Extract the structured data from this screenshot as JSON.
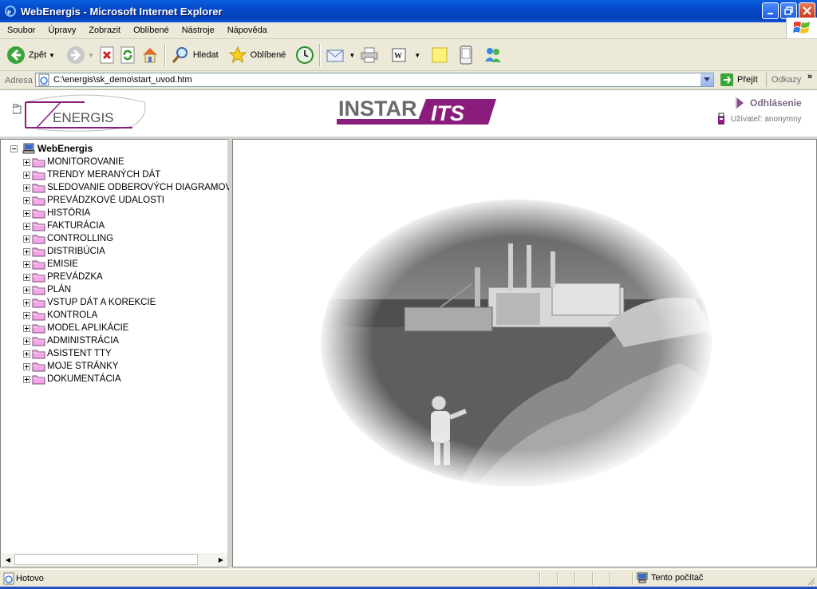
{
  "window": {
    "title": "WebEnergis - Microsoft Internet Explorer"
  },
  "menu": [
    "Soubor",
    "Úpravy",
    "Zobrazit",
    "Oblíbené",
    "Nástroje",
    "Nápověda"
  ],
  "toolbar": {
    "back": "Zpět",
    "search": "Hledat",
    "favorites": "Oblíbené"
  },
  "address": {
    "label": "Adresa",
    "url": "C:\\energis\\sk_demo\\start_uvod.htm",
    "go": "Přejít",
    "links": "Odkazy"
  },
  "header": {
    "logo_text": "ENERGIS",
    "product_logo": "INSTAR ITS",
    "logout": "Odhlásenie",
    "user": "Užívateľ: anonymny"
  },
  "tree": {
    "root": "WebEnergis",
    "items": [
      "MONITOROVANIE",
      "TRENDY MERANÝCH DÁT",
      "SLEDOVANIE ODBEROVÝCH DIAGRAMOV",
      "PREVÁDZKOVÉ UDALOSTI",
      "HISTÓRIA",
      "FAKTURÁCIA",
      "CONTROLLING",
      "DISTRIBÚCIA",
      "EMISIE",
      "PREVÁDZKA",
      "PLÁN",
      "VSTUP DÁT A KOREKCIE",
      "KONTROLA",
      "MODEL APLIKÁCIE",
      "ADMINISTRÁCIA",
      "ASISTENT TTY",
      "MOJE STRÁNKY",
      "DOKUMENTÁCIA"
    ]
  },
  "status": {
    "text": "Hotovo",
    "zone": "Tento počítač"
  },
  "colors": {
    "titlebar": "#0548c8",
    "brand_purple": "#8a1c7c",
    "folder_pink": "#f4a6e8"
  }
}
